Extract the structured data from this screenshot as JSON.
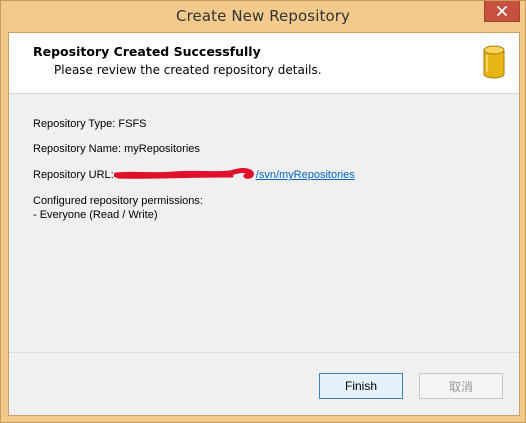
{
  "window": {
    "title": "Create New Repository"
  },
  "header": {
    "title": "Repository Created Successfully",
    "subtitle": "Please review the created repository details."
  },
  "details": {
    "type_label": "Repository Type: FSFS",
    "name_label": "Repository Name: myRepositories",
    "url_prefix": "Repository URL: ",
    "url_visible_part": "/svn/myRepositories",
    "permissions_heading": "Configured repository permissions:",
    "permissions_entry": "- Everyone (Read / Write)"
  },
  "buttons": {
    "finish": "Finish",
    "cancel": "取消"
  },
  "colors": {
    "frame": "#f2ca8c",
    "close": "#c7503f",
    "link": "#0563c1",
    "redaction": "#e0102a"
  },
  "icons": {
    "close": "close-icon",
    "database": "database-icon"
  }
}
